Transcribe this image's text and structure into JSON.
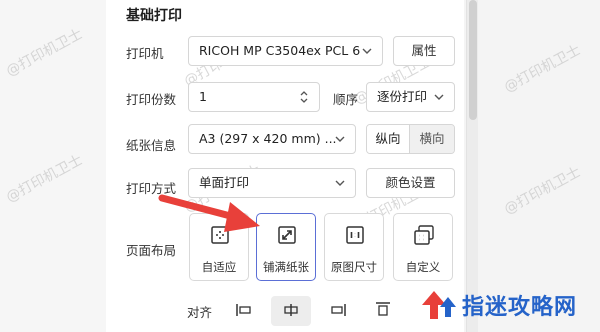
{
  "section": {
    "title": "基础打印"
  },
  "printer": {
    "label": "打印机",
    "value": "RICOH MP C3504ex PCL 6",
    "properties_button": "属性"
  },
  "copies": {
    "label": "打印份数",
    "value": "1",
    "order_label": "顺序",
    "order_value": "逐份打印"
  },
  "paper": {
    "label": "纸张信息",
    "value": "A3 (297 x 420 mm) ...",
    "orientation": [
      {
        "label": "纵向",
        "selected": true
      },
      {
        "label": "横向",
        "selected": false
      }
    ]
  },
  "print_mode": {
    "label": "打印方式",
    "value": "单面打印",
    "color_button": "颜色设置"
  },
  "page_layout": {
    "label": "页面布局",
    "options": [
      {
        "label": "自适应",
        "icon": "fit-page-icon",
        "selected": false
      },
      {
        "label": "铺满纸张",
        "icon": "expand-fill-icon",
        "selected": true
      },
      {
        "label": "原图尺寸",
        "icon": "original-size-icon",
        "selected": false
      },
      {
        "label": "自定义",
        "icon": "custom-layout-icon",
        "selected": false
      }
    ]
  },
  "alignment": {
    "label": "对齐",
    "options": [
      {
        "icon": "align-left-icon",
        "selected": false
      },
      {
        "icon": "align-center-icon",
        "selected": true
      },
      {
        "icon": "align-right-icon",
        "selected": false
      },
      {
        "icon": "align-top-icon",
        "selected": false
      }
    ]
  },
  "watermark_text": "@打印机卫士",
  "brand": {
    "name": "指迷攻略网"
  },
  "colors": {
    "accent": "#5b6fd6",
    "arrow": "#e8403a",
    "brand": "#2563c9"
  }
}
